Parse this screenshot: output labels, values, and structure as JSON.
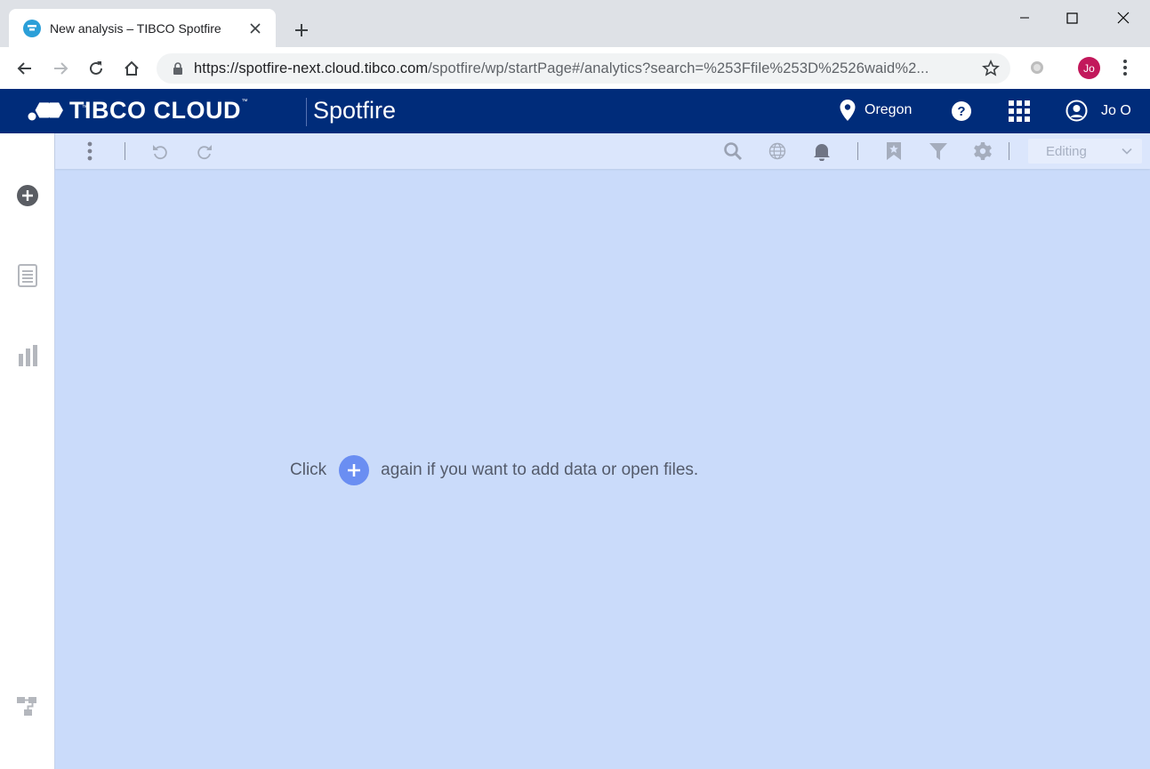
{
  "browser": {
    "tab_title": "New analysis – TIBCO Spotfire",
    "url_host": "https://spotfire-next.cloud.tibco.com",
    "url_path": "/spotfire/wp/startPage#/analytics?search=%253Ffile%253D%2526waid%2...",
    "profile_initials": "Jo",
    "profile_color": "#c2185b"
  },
  "app": {
    "brand": "TIBCO CLOUD",
    "brand_tm": "™",
    "name": "Spotfire",
    "region": "Oregon",
    "user": "Jo O",
    "header_color": "#002c7a"
  },
  "toolbar": {
    "mode": "Editing"
  },
  "hint": {
    "before": "Click",
    "after": "again if you want to add data or open files."
  },
  "icons": {
    "rail": [
      "add-circle-icon",
      "pages-icon",
      "visualizations-icon",
      "data-canvas-icon"
    ],
    "toolbar": [
      "more-vertical-icon",
      "undo-icon",
      "redo-icon",
      "search-icon",
      "globe-icon",
      "bell-icon",
      "bookmark-icon",
      "filter-icon",
      "gear-icon",
      "chevron-down-icon"
    ]
  }
}
